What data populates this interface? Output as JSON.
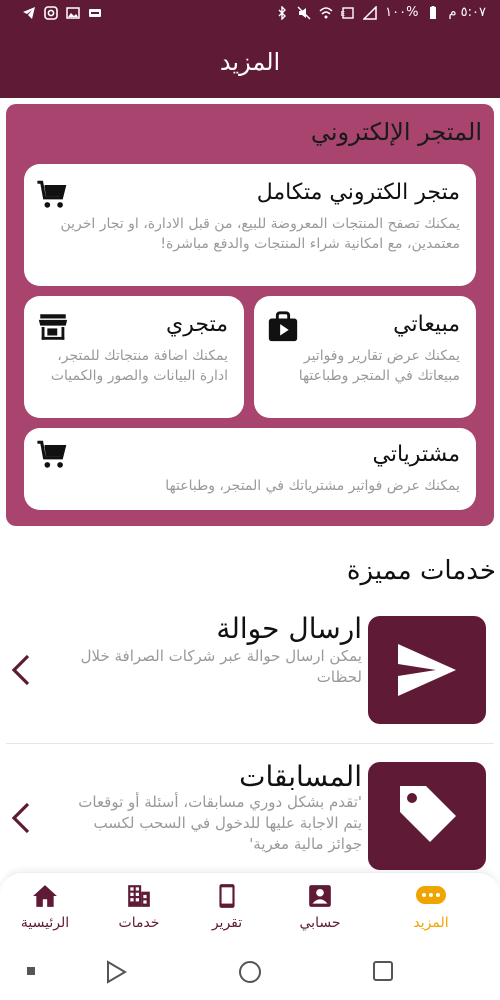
{
  "status": {
    "time": "٥:٠٧ م",
    "battery": "%١٠٠"
  },
  "header": {
    "title": "المزيد"
  },
  "store": {
    "title": "المتجر الإلكتروني",
    "full_store": {
      "title": "متجر الكتروني متكامل",
      "desc": "يمكنك تصفح المنتجات المعروضة للبيع، من قبل الادارة، او تجار اخرين معتمدين، مع امكانية شراء المنتجات والدفع مباشرة!",
      "icon": "shopping-cart-icon"
    },
    "sales": {
      "title": "مبيعاتي",
      "desc": "يمكنك عرض تقارير وفواتير مبيعاتك في المتجر وطباعتها",
      "icon": "shopping-bag-icon"
    },
    "my_store": {
      "title": "متجري",
      "desc": "يمكنك اضافة منتجاتك للمتجر، ادارة البيانات والصور والكميات",
      "icon": "storefront-icon"
    },
    "purchases": {
      "title": "مشترياتي",
      "desc": "يمكنك عرض فواتير مشترياتك في المتجر، وطباعتها",
      "icon": "shopping-cart-icon"
    }
  },
  "featured": {
    "title": "خدمات مميزة",
    "items": [
      {
        "title": "ارسال حوالة",
        "desc": "يمكن ارسال حوالة عبر شركات الصرافة خلال لحظات",
        "icon": "send-icon"
      },
      {
        "title": "المسابقات",
        "desc": "'تقدم بشكل دوري مسابقات، أسئلة أو توقعات يتم الاجابة عليها للدخول في السحب لكسب جوائز مالية مغرية'",
        "icon": "tag-icon"
      }
    ]
  },
  "bottom_nav": {
    "items": [
      {
        "label": "الرئيسية",
        "icon": "home-icon"
      },
      {
        "label": "خدمات",
        "icon": "building-icon"
      },
      {
        "label": "تقرير",
        "icon": "phone-icon"
      },
      {
        "label": "حسابي",
        "icon": "account-icon"
      },
      {
        "label": "المزيد",
        "icon": "more-icon",
        "active": true
      }
    ]
  },
  "colors": {
    "primary": "#5f1a36",
    "store_bg": "#a8446e",
    "active": "#f0a400"
  }
}
